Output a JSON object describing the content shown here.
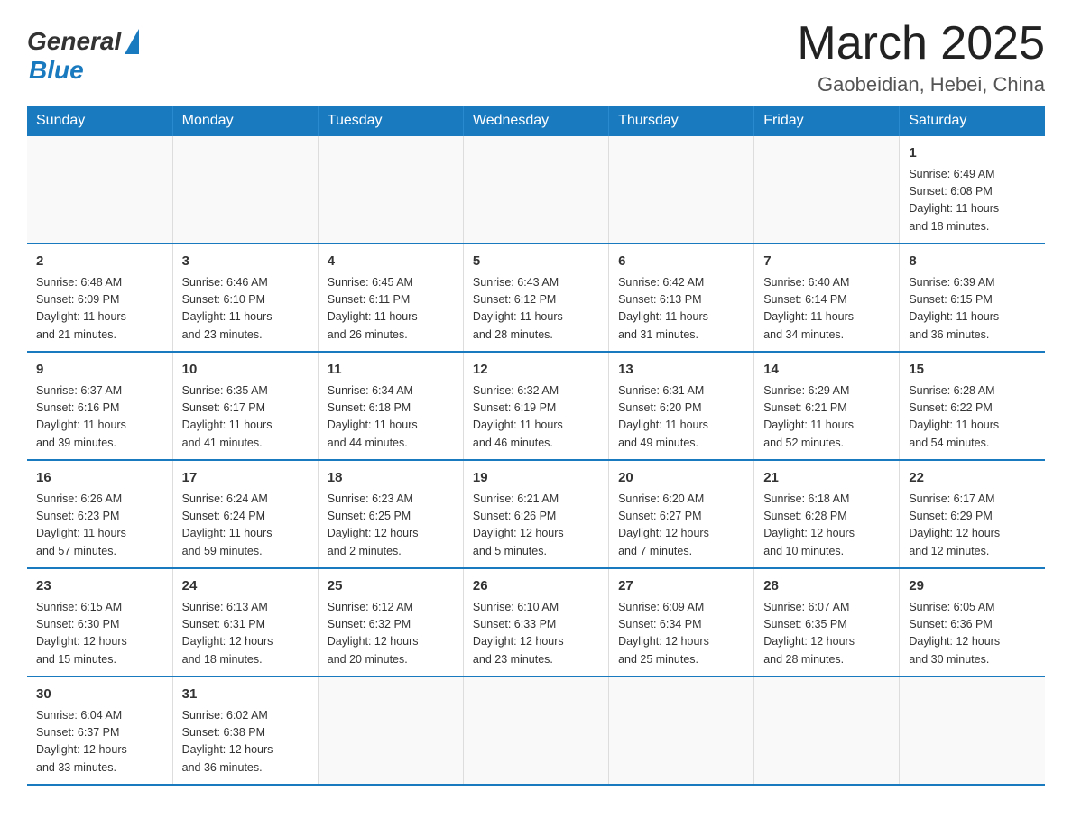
{
  "header": {
    "logo_general": "General",
    "logo_blue": "Blue",
    "month_title": "March 2025",
    "location": "Gaobeidian, Hebei, China"
  },
  "calendar": {
    "days_of_week": [
      "Sunday",
      "Monday",
      "Tuesday",
      "Wednesday",
      "Thursday",
      "Friday",
      "Saturday"
    ],
    "weeks": [
      [
        {
          "day": "",
          "info": ""
        },
        {
          "day": "",
          "info": ""
        },
        {
          "day": "",
          "info": ""
        },
        {
          "day": "",
          "info": ""
        },
        {
          "day": "",
          "info": ""
        },
        {
          "day": "",
          "info": ""
        },
        {
          "day": "1",
          "info": "Sunrise: 6:49 AM\nSunset: 6:08 PM\nDaylight: 11 hours\nand 18 minutes."
        }
      ],
      [
        {
          "day": "2",
          "info": "Sunrise: 6:48 AM\nSunset: 6:09 PM\nDaylight: 11 hours\nand 21 minutes."
        },
        {
          "day": "3",
          "info": "Sunrise: 6:46 AM\nSunset: 6:10 PM\nDaylight: 11 hours\nand 23 minutes."
        },
        {
          "day": "4",
          "info": "Sunrise: 6:45 AM\nSunset: 6:11 PM\nDaylight: 11 hours\nand 26 minutes."
        },
        {
          "day": "5",
          "info": "Sunrise: 6:43 AM\nSunset: 6:12 PM\nDaylight: 11 hours\nand 28 minutes."
        },
        {
          "day": "6",
          "info": "Sunrise: 6:42 AM\nSunset: 6:13 PM\nDaylight: 11 hours\nand 31 minutes."
        },
        {
          "day": "7",
          "info": "Sunrise: 6:40 AM\nSunset: 6:14 PM\nDaylight: 11 hours\nand 34 minutes."
        },
        {
          "day": "8",
          "info": "Sunrise: 6:39 AM\nSunset: 6:15 PM\nDaylight: 11 hours\nand 36 minutes."
        }
      ],
      [
        {
          "day": "9",
          "info": "Sunrise: 6:37 AM\nSunset: 6:16 PM\nDaylight: 11 hours\nand 39 minutes."
        },
        {
          "day": "10",
          "info": "Sunrise: 6:35 AM\nSunset: 6:17 PM\nDaylight: 11 hours\nand 41 minutes."
        },
        {
          "day": "11",
          "info": "Sunrise: 6:34 AM\nSunset: 6:18 PM\nDaylight: 11 hours\nand 44 minutes."
        },
        {
          "day": "12",
          "info": "Sunrise: 6:32 AM\nSunset: 6:19 PM\nDaylight: 11 hours\nand 46 minutes."
        },
        {
          "day": "13",
          "info": "Sunrise: 6:31 AM\nSunset: 6:20 PM\nDaylight: 11 hours\nand 49 minutes."
        },
        {
          "day": "14",
          "info": "Sunrise: 6:29 AM\nSunset: 6:21 PM\nDaylight: 11 hours\nand 52 minutes."
        },
        {
          "day": "15",
          "info": "Sunrise: 6:28 AM\nSunset: 6:22 PM\nDaylight: 11 hours\nand 54 minutes."
        }
      ],
      [
        {
          "day": "16",
          "info": "Sunrise: 6:26 AM\nSunset: 6:23 PM\nDaylight: 11 hours\nand 57 minutes."
        },
        {
          "day": "17",
          "info": "Sunrise: 6:24 AM\nSunset: 6:24 PM\nDaylight: 11 hours\nand 59 minutes."
        },
        {
          "day": "18",
          "info": "Sunrise: 6:23 AM\nSunset: 6:25 PM\nDaylight: 12 hours\nand 2 minutes."
        },
        {
          "day": "19",
          "info": "Sunrise: 6:21 AM\nSunset: 6:26 PM\nDaylight: 12 hours\nand 5 minutes."
        },
        {
          "day": "20",
          "info": "Sunrise: 6:20 AM\nSunset: 6:27 PM\nDaylight: 12 hours\nand 7 minutes."
        },
        {
          "day": "21",
          "info": "Sunrise: 6:18 AM\nSunset: 6:28 PM\nDaylight: 12 hours\nand 10 minutes."
        },
        {
          "day": "22",
          "info": "Sunrise: 6:17 AM\nSunset: 6:29 PM\nDaylight: 12 hours\nand 12 minutes."
        }
      ],
      [
        {
          "day": "23",
          "info": "Sunrise: 6:15 AM\nSunset: 6:30 PM\nDaylight: 12 hours\nand 15 minutes."
        },
        {
          "day": "24",
          "info": "Sunrise: 6:13 AM\nSunset: 6:31 PM\nDaylight: 12 hours\nand 18 minutes."
        },
        {
          "day": "25",
          "info": "Sunrise: 6:12 AM\nSunset: 6:32 PM\nDaylight: 12 hours\nand 20 minutes."
        },
        {
          "day": "26",
          "info": "Sunrise: 6:10 AM\nSunset: 6:33 PM\nDaylight: 12 hours\nand 23 minutes."
        },
        {
          "day": "27",
          "info": "Sunrise: 6:09 AM\nSunset: 6:34 PM\nDaylight: 12 hours\nand 25 minutes."
        },
        {
          "day": "28",
          "info": "Sunrise: 6:07 AM\nSunset: 6:35 PM\nDaylight: 12 hours\nand 28 minutes."
        },
        {
          "day": "29",
          "info": "Sunrise: 6:05 AM\nSunset: 6:36 PM\nDaylight: 12 hours\nand 30 minutes."
        }
      ],
      [
        {
          "day": "30",
          "info": "Sunrise: 6:04 AM\nSunset: 6:37 PM\nDaylight: 12 hours\nand 33 minutes."
        },
        {
          "day": "31",
          "info": "Sunrise: 6:02 AM\nSunset: 6:38 PM\nDaylight: 12 hours\nand 36 minutes."
        },
        {
          "day": "",
          "info": ""
        },
        {
          "day": "",
          "info": ""
        },
        {
          "day": "",
          "info": ""
        },
        {
          "day": "",
          "info": ""
        },
        {
          "day": "",
          "info": ""
        }
      ]
    ]
  }
}
